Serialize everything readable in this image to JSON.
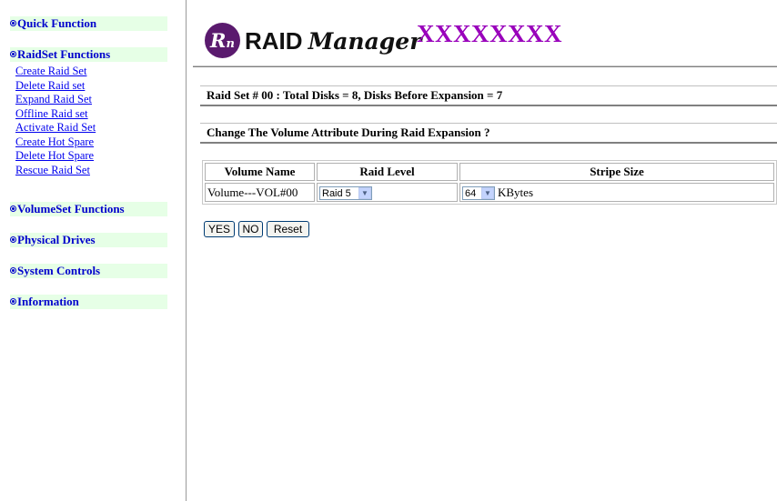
{
  "nav": {
    "quick_function": "Quick Function",
    "raidset_functions": "RaidSet Functions",
    "raidset_items": [
      "Create Raid Set",
      "Delete Raid set",
      "Expand Raid Set",
      "Offline Raid set",
      "Activate Raid Set",
      "Create Hot Spare",
      "Delete Hot Spare",
      "Rescue Raid Set"
    ],
    "volumeset_functions": "VolumeSet Functions",
    "physical_drives": "Physical Drives",
    "system_controls": "System Controls",
    "information": "Information"
  },
  "banner": {
    "logo_mark": "R",
    "logo_word_raid": "RAID",
    "logo_word_manager": "Manager",
    "product_name": "XXXXXXXX"
  },
  "raid_info": "Raid Set # 00 : Total Disks = 8, Disks Before Expansion = 7",
  "question": "Change The Volume Attribute During Raid Expansion ?",
  "table": {
    "headers": [
      "Volume Name",
      "Raid Level",
      "Stripe Size"
    ],
    "row": {
      "volume_name": "Volume---VOL#00",
      "raid_level": "Raid 5",
      "stripe_size": "64",
      "stripe_units": "KBytes"
    }
  },
  "buttons": {
    "yes": "YES",
    "no": "NO",
    "reset": "Reset"
  },
  "colors": {
    "section_bg": "#e6ffe6",
    "section_text": "#0000cc",
    "link": "#0000ee",
    "product_name": "#9900bb",
    "logo_circle": "#5a1a6e"
  }
}
